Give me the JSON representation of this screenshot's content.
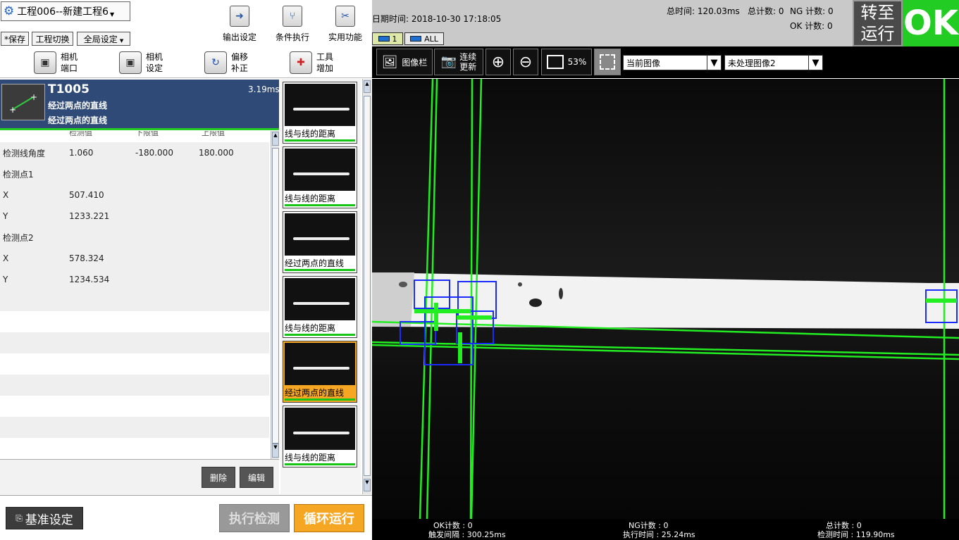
{
  "header": {
    "project_title": "工程006--新建工程6",
    "save_label": "*保存",
    "switch_label": "工程切换",
    "global_label": "全局设定",
    "output_label": "输出设定",
    "condition_label": "条件执行",
    "utility_label": "实用功能"
  },
  "info": {
    "datetime": "日期时间: 2018-10-30 17:18:05",
    "total_time": "总时间:  120.03ms",
    "total_count": "总计数: 0",
    "ng_count": "NG 计数: 0",
    "ok_count": "OK 计数: 0",
    "cam_tab_1": "1",
    "cam_tab_all": "ALL",
    "switch_run_1": "转至",
    "switch_run_2": "运行",
    "result": "OK"
  },
  "row2": {
    "camera_port_1": "相机",
    "camera_port_2": "端口",
    "camera_settings_1": "相机",
    "camera_settings_2": "设定",
    "offset_1": "偏移",
    "offset_2": "补正",
    "tool_add_1": "工具",
    "tool_add_2": "增加"
  },
  "image_toolbar": {
    "image_bar": "图像栏",
    "continuous_1": "连续",
    "continuous_2": "更新",
    "zoom": "53%",
    "current_image": "当前图像",
    "unprocessed_image": "未处理图像2"
  },
  "tool": {
    "id": "T1005",
    "time": "3.19ms",
    "name1": "经过两点的直线",
    "name2": "经过两点的直线",
    "col_detect": "检测值",
    "col_lower": "下限值",
    "col_upper": "上限值"
  },
  "rows": [
    {
      "label": "检测线角度",
      "v1": "1.060",
      "v2": "-180.000",
      "v3": "180.000"
    },
    {
      "label": "检测点1",
      "v1": "",
      "v2": "",
      "v3": ""
    },
    {
      "label": "X",
      "v1": "507.410",
      "v2": "",
      "v3": ""
    },
    {
      "label": "Y",
      "v1": "1233.221",
      "v2": "",
      "v3": ""
    },
    {
      "label": "检测点2",
      "v1": "",
      "v2": "",
      "v3": ""
    },
    {
      "label": "X",
      "v1": "578.324",
      "v2": "",
      "v3": ""
    },
    {
      "label": "Y",
      "v1": "1234.534",
      "v2": "",
      "v3": ""
    }
  ],
  "buttons": {
    "delete": "删除",
    "edit": "编辑",
    "reference": "基准设定",
    "execute": "执行检测",
    "loop": "循环运行"
  },
  "thumbnails": [
    {
      "label": "线与线的距离"
    },
    {
      "label": "线与线的距离"
    },
    {
      "label": "经过两点的直线"
    },
    {
      "label": "线与线的距离"
    },
    {
      "label": "经过两点的直线"
    },
    {
      "label": "线与线的距离"
    }
  ],
  "status": {
    "ok_count": "OK计数 : 0",
    "trigger_interval": "触发间隔 : 300.25ms",
    "ng_count": "NG计数 : 0",
    "exec_time": "执行时间 : 25.24ms",
    "total_count": "总计数 : 0",
    "detect_time": "检测时间 : 119.90ms"
  },
  "colors": {
    "accent_green": "#22cc22",
    "header_blue": "#2f4a77",
    "loop_orange": "#f5a623"
  }
}
